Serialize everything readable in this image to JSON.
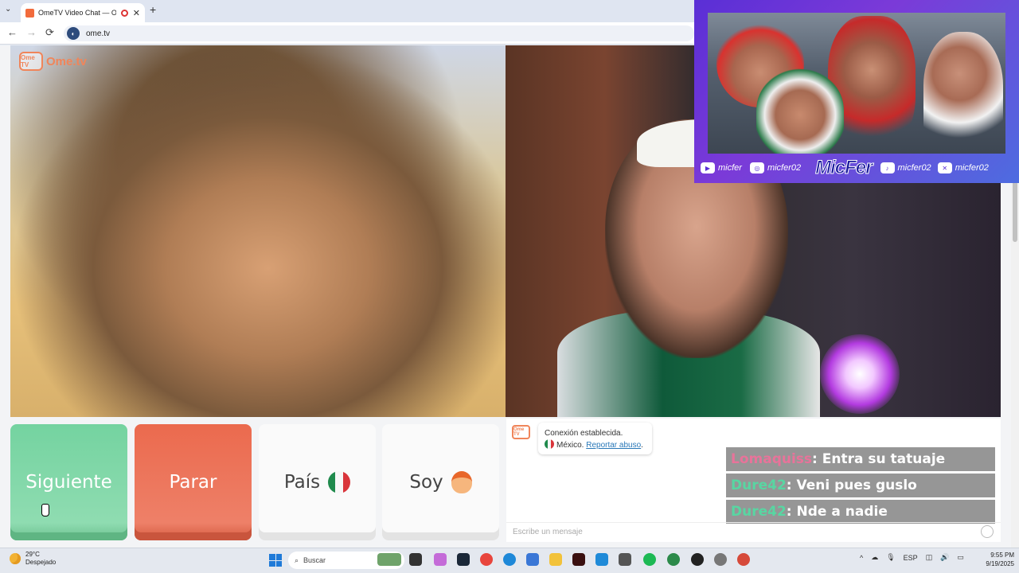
{
  "browser": {
    "tab_title": "OmeTV Video Chat — Ome",
    "url": "ome.tv",
    "tab_close": "✕",
    "new_tab": "+",
    "tab_list": "⌄",
    "nav": {
      "back": "←",
      "forward": "→",
      "reload": "⟳"
    }
  },
  "site": {
    "logo_badge": "Ome TV",
    "logo_text": "Ome.tv"
  },
  "buttons": {
    "next": "Siguiente",
    "stop": "Parar",
    "country": "País",
    "gender": "Soy"
  },
  "chat": {
    "badge": "Ome TV",
    "status": "Conexión establecida.",
    "country": "México.",
    "report": "Reportar abuso",
    "report_suffix": ".",
    "input_placeholder": "Escribe un mensaje"
  },
  "stream_chat": [
    {
      "user": "Lomaquiss",
      "text": ": Entra su tatuaje",
      "color": "#e8739a"
    },
    {
      "user": "Dure42",
      "text": ": Veni pues guslo",
      "color": "#58d6a2"
    },
    {
      "user": "Dure42",
      "text": ": Nde a nadie",
      "color": "#58d6a2"
    }
  ],
  "overlay": {
    "youtube": "micfer",
    "instagram": "micfer02",
    "brand": "MicFer",
    "tiktok": "micfer02",
    "x": "micfer02"
  },
  "taskbar": {
    "temp": "29°C",
    "weather": "Despejado",
    "search": "Buscar",
    "language": "ESP",
    "time": "9:55 PM",
    "date": "9/19/2025"
  },
  "colors": {
    "next_button": "#74d3a0",
    "stop_button": "#eb6a4e",
    "brand_orange": "#f0855a",
    "overlay_purple": "#5a2fd6"
  }
}
